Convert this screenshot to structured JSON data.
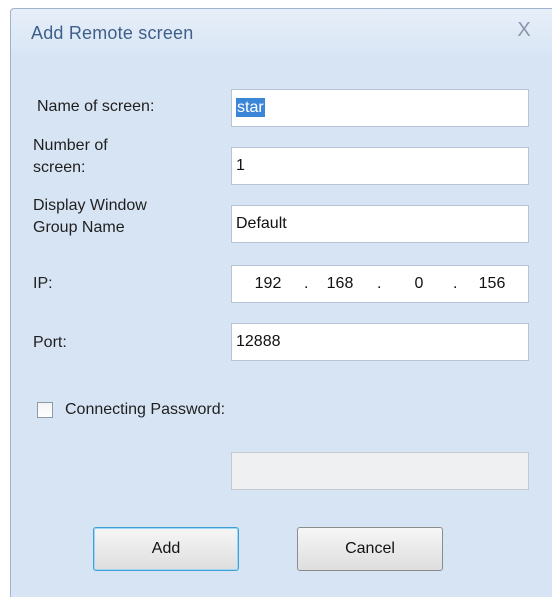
{
  "dialog": {
    "title": "Add Remote screen",
    "close_icon": "close-icon",
    "close_glyph": "X"
  },
  "fields": {
    "name": {
      "label": "Name of screen:",
      "value": "star",
      "selected": true
    },
    "number": {
      "label_line1": "Number of",
      "label_line2": "screen:",
      "value": "1"
    },
    "group": {
      "label_line1": "Display Window",
      "label_line2": "Group Name",
      "value": "Default"
    },
    "ip": {
      "label": "IP:",
      "octets": [
        "192",
        "168",
        "0",
        "156"
      ],
      "separator": "."
    },
    "port": {
      "label": "Port:",
      "value": "12888"
    }
  },
  "password": {
    "checkbox_label": "Connecting Password:",
    "checked": false,
    "value": ""
  },
  "buttons": {
    "add": "Add",
    "cancel": "Cancel"
  },
  "colors": {
    "dialog_background": "#d7e4f4",
    "title_text": "#3e5f8a",
    "selection": "#3c86d8",
    "default_button_border": "#3f9fd6"
  }
}
